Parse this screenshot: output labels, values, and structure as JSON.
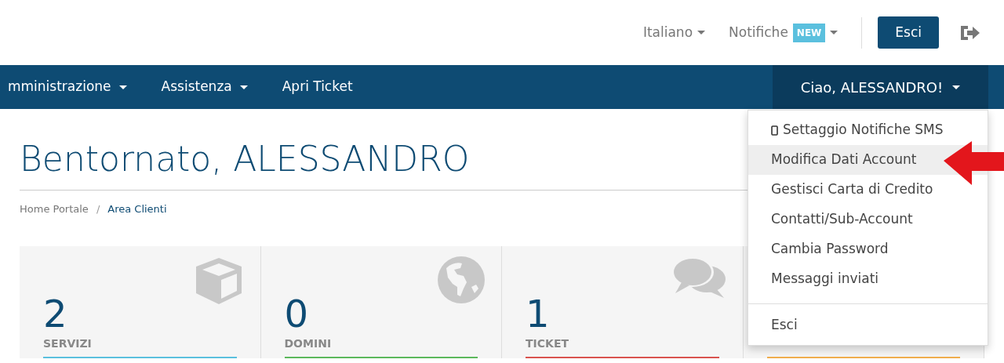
{
  "top_bar": {
    "language": "Italiano",
    "notifications": "Notifiche",
    "notifications_badge": "NEW",
    "logout_button": "Esci"
  },
  "nav": {
    "items": [
      {
        "label": "mministrazione",
        "dropdown": true
      },
      {
        "label": "Assistenza",
        "dropdown": true
      },
      {
        "label": "Apri Ticket",
        "dropdown": false
      }
    ],
    "user_menu": "Ciao, ALESSANDRO!",
    "user_menu_expanded": true
  },
  "user_dropdown": {
    "items": [
      {
        "label": "Settaggio Notifiche SMS",
        "kind": "with_icon",
        "selected": false
      },
      {
        "label": "Modifica Dati Account",
        "kind": "plain",
        "selected": true
      },
      {
        "label": "Gestisci Carta di Credito",
        "kind": "plain",
        "selected": false
      },
      {
        "label": "Contatti/Sub-Account",
        "kind": "plain",
        "selected": false
      },
      {
        "label": "Cambia Password",
        "kind": "plain",
        "selected": false
      },
      {
        "label": "Messaggi inviati",
        "kind": "plain",
        "selected": false
      }
    ],
    "footer_items": [
      {
        "label": "Esci"
      }
    ]
  },
  "heading": "Bentornato, ALESSANDRO",
  "breadcrumb": [
    {
      "label": "Home Portale",
      "selected": false
    },
    {
      "label": "Area Clienti",
      "selected": true
    }
  ],
  "breadcrumb_separator": "/",
  "tiles": [
    {
      "count": "2",
      "label": "SERVIZI",
      "color": "#5bc0de"
    },
    {
      "count": "0",
      "label": "DOMINI",
      "color": "#5cb85c"
    },
    {
      "count": "1",
      "label": "TICKET",
      "color": "#d9534f"
    },
    {
      "color": "#f0ad4e"
    }
  ]
}
